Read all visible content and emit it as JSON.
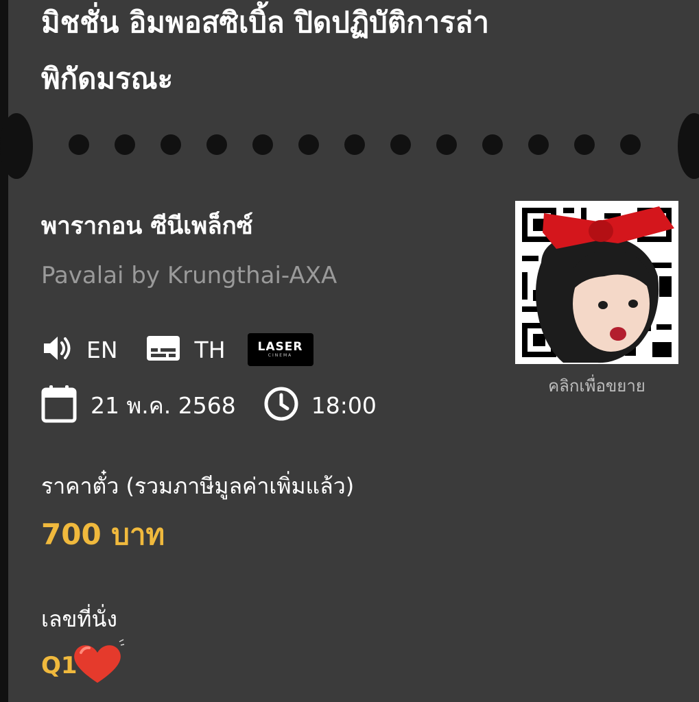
{
  "movie": {
    "title_line1": "มิชชั่น อิมพอสซิเบิ้ล ปิดปฏิบัติการล่า",
    "title_line2": "พิกัดมรณะ"
  },
  "venue": {
    "name_th": "พารากอน ซีนีเพล็กซ์",
    "name_en": "Pavalai by Krungthai-AXA"
  },
  "format": {
    "audio_icon": "speaker-icon",
    "audio": "EN",
    "subtitle_icon": "subtitles-icon",
    "subtitle": "TH",
    "badge_title": "LASER",
    "badge_sub": "CINEMA"
  },
  "showtime": {
    "date_icon": "calendar-icon",
    "date": "21 พ.ค. 2568",
    "time_icon": "clock-icon",
    "time": "18:00"
  },
  "price": {
    "label": "ราคาตั๋ว (รวมภาษีมูลค่าเพิ่มแล้ว)",
    "value": "700 บาท"
  },
  "seat": {
    "label": "เลขที่นั่ง",
    "value": "Q1"
  },
  "qr": {
    "caption": "คลิกเพื่อขยาย"
  },
  "colors": {
    "card_bg": "#3b3b3b",
    "page_bg": "#111111",
    "accent": "#f0b93d",
    "muted": "#9a9a9a"
  }
}
